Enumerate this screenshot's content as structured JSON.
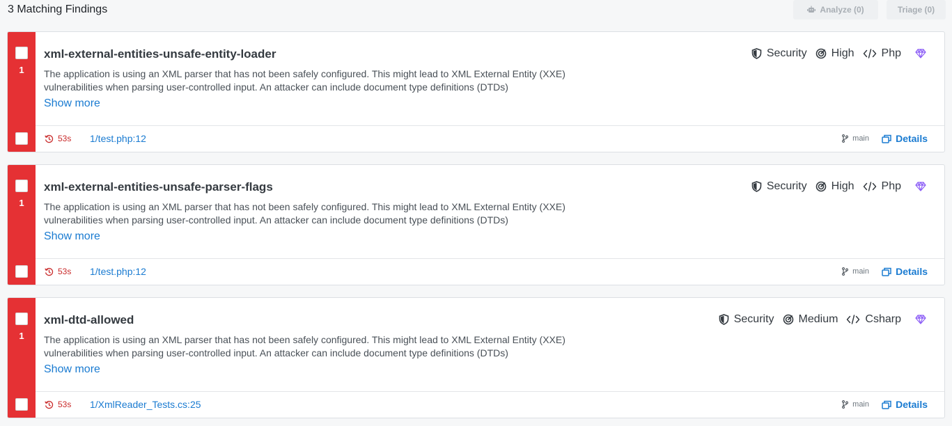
{
  "header": {
    "title": "3 Matching Findings",
    "analyze_label": "Analyze (0)",
    "triage_label": "Triage (0)"
  },
  "findings": [
    {
      "count": "1",
      "title": "xml-external-entities-unsafe-entity-loader",
      "description": "The application is using an XML parser that has not been safely configured. This might lead to XML External Entity (XXE) vulnerabilities when parsing user-controlled input. An attacker can include document type definitions (DTDs)",
      "show_more": "Show more",
      "category": "Security",
      "confidence": "High",
      "language": "Php",
      "time": "53s",
      "location": "1/test.php:12",
      "branch": "main",
      "details": "Details"
    },
    {
      "count": "1",
      "title": "xml-external-entities-unsafe-parser-flags",
      "description": "The application is using an XML parser that has not been safely configured. This might lead to XML External Entity (XXE) vulnerabilities when parsing user-controlled input. An attacker can include document type definitions (DTDs)",
      "show_more": "Show more",
      "category": "Security",
      "confidence": "High",
      "language": "Php",
      "time": "53s",
      "location": "1/test.php:12",
      "branch": "main",
      "details": "Details"
    },
    {
      "count": "1",
      "title": "xml-dtd-allowed",
      "description": "The application is using an XML parser that has not been safely configured. This might lead to XML External Entity (XXE) vulnerabilities when parsing user-controlled input. An attacker can include document type definitions (DTDs)",
      "show_more": "Show more",
      "category": "Security",
      "confidence": "Medium",
      "language": "Csharp",
      "time": "53s",
      "location": "1/XmlReader_Tests.cs:25",
      "branch": "main",
      "details": "Details"
    }
  ],
  "icons": {
    "category": "shield-icon",
    "confidence": "gauge-icon",
    "language": "code-icon",
    "pro": "gem-icon",
    "time": "history-icon",
    "branch": "git-branch-icon",
    "details": "window-icon",
    "analyze": "robot-icon"
  },
  "colors": {
    "severity_bar": "#e53134",
    "link": "#1a7bd1",
    "gem": "#8b5cf6",
    "time": "#c92a2a"
  }
}
